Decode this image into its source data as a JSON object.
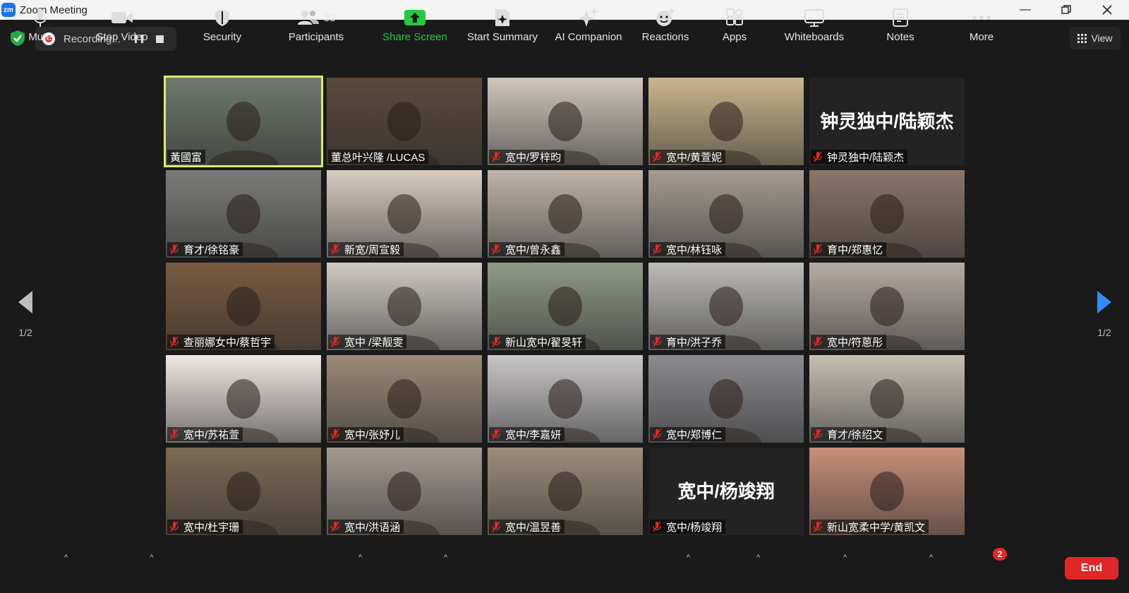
{
  "window": {
    "title": "Zoom Meeting",
    "app_icon_text": "zm"
  },
  "topbar": {
    "recording_label": "Recording...",
    "view_label": "View"
  },
  "pager": {
    "left": "1/2",
    "right": "1/2"
  },
  "participants_grid": [
    {
      "name": "黃國富",
      "muted": false,
      "speaker": true,
      "kind": "video",
      "bg": "#6f7a6c"
    },
    {
      "name": "董总叶兴隆 /LUCAS",
      "muted": false,
      "speaker": false,
      "kind": "video",
      "bg": "#5b4a3c"
    },
    {
      "name": "宽中/罗梓昀",
      "muted": true,
      "speaker": false,
      "kind": "video",
      "bg": "#cfc6bc"
    },
    {
      "name": "宽中/黄萱妮",
      "muted": true,
      "speaker": false,
      "kind": "video",
      "bg": "#cbb68d"
    },
    {
      "name": "钟灵独中/陆颖杰",
      "muted": true,
      "speaker": false,
      "kind": "name",
      "display": "钟灵独中/陆颖杰"
    },
    {
      "name": "育才/徐铭豪",
      "muted": true,
      "speaker": false,
      "kind": "video",
      "bg": "#7c7c7a"
    },
    {
      "name": "新宽/周宣毅",
      "muted": true,
      "speaker": false,
      "kind": "video",
      "bg": "#d8ccc0"
    },
    {
      "name": "宽中/曾永鑫",
      "muted": true,
      "speaker": false,
      "kind": "video",
      "bg": "#bfb5a9"
    },
    {
      "name": "宽中/林钰咏",
      "muted": true,
      "speaker": false,
      "kind": "video",
      "bg": "#a59c92"
    },
    {
      "name": "育中/郑惠忆",
      "muted": true,
      "speaker": false,
      "kind": "video",
      "bg": "#8b756a"
    },
    {
      "name": "查丽娜女中/蔡哲宇",
      "muted": true,
      "speaker": false,
      "kind": "video",
      "bg": "#7a5a40"
    },
    {
      "name": "宽中 /梁靓雯",
      "muted": true,
      "speaker": false,
      "kind": "video",
      "bg": "#cfcac2"
    },
    {
      "name": "新山宽中/翟旻轩",
      "muted": true,
      "speaker": false,
      "kind": "video",
      "bg": "#8f9a86"
    },
    {
      "name": "育中/洪子乔",
      "muted": true,
      "speaker": false,
      "kind": "video",
      "bg": "#bdbbb6"
    },
    {
      "name": "宽中/符蒽彤",
      "muted": true,
      "speaker": false,
      "kind": "video",
      "bg": "#b6aba4"
    },
    {
      "name": "宽中/苏祐萱",
      "muted": true,
      "speaker": false,
      "kind": "video",
      "bg": "#f0e8e2"
    },
    {
      "name": "宽中/张妤儿",
      "muted": true,
      "speaker": false,
      "kind": "video",
      "bg": "#9c8a78"
    },
    {
      "name": "宽中/李嘉妍",
      "muted": true,
      "speaker": false,
      "kind": "video",
      "bg": "#c9c6c8"
    },
    {
      "name": "宽中/郑博仁",
      "muted": true,
      "speaker": false,
      "kind": "video",
      "bg": "#8d8b8f"
    },
    {
      "name": "育才/徐绍文",
      "muted": true,
      "speaker": false,
      "kind": "video",
      "bg": "#c6bfb4"
    },
    {
      "name": "宽中/杜宇珊",
      "muted": true,
      "speaker": false,
      "kind": "video",
      "bg": "#7c6a54"
    },
    {
      "name": "宽中/洪语涵",
      "muted": true,
      "speaker": false,
      "kind": "video",
      "bg": "#a59a92"
    },
    {
      "name": "宽中/温昱善",
      "muted": true,
      "speaker": false,
      "kind": "video",
      "bg": "#9d8e7c"
    },
    {
      "name": "宽中/杨竣翔",
      "muted": true,
      "speaker": false,
      "kind": "name",
      "display": "宽中/杨竣翔"
    },
    {
      "name": "新山宽柔中学/黄凯文",
      "muted": true,
      "speaker": false,
      "kind": "video",
      "bg": "#c9907a"
    }
  ],
  "toolbar": {
    "mute": "Mute",
    "stop_video": "Stop Video",
    "security": "Security",
    "participants": "Participants",
    "participants_count": "33",
    "share_screen": "Share Screen",
    "start_summary": "Start Summary",
    "ai_companion": "AI Companion",
    "reactions": "Reactions",
    "apps": "Apps",
    "whiteboards": "Whiteboards",
    "notes": "Notes",
    "more": "More",
    "more_badge": "2",
    "end": "End"
  },
  "colors": {
    "accent_green": "#28c840",
    "end_red": "#e02828",
    "speaker_outline": "#d8ec6a"
  }
}
